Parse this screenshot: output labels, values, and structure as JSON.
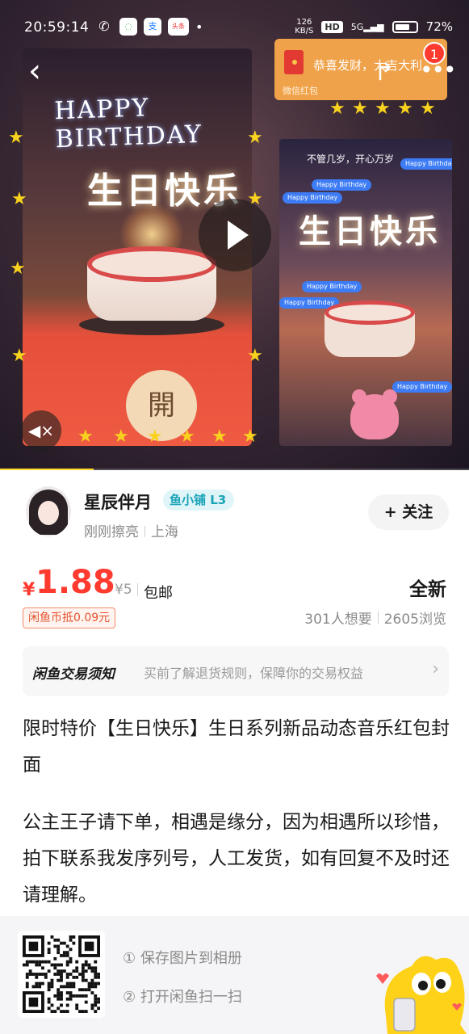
{
  "status_bar": {
    "time": "20:59:14",
    "app_icons": [
      {
        "name": "wechat-icon",
        "glyph": "✆",
        "color": "#ffffff"
      },
      {
        "name": "refresh-app-icon",
        "glyph": "◌",
        "color": "#4cc45a"
      },
      {
        "name": "alipay-icon",
        "glyph": "支",
        "color": "#1677ff"
      },
      {
        "name": "toutiao-icon",
        "glyph": "头条",
        "color": "#e83a35"
      }
    ],
    "net_speed_value": "126",
    "net_speed_unit": "KB/S",
    "hd_label": "HD",
    "signal_label": "5G",
    "battery": "72%"
  },
  "hero": {
    "banner_text": "HAPPY BIRTHDAY",
    "left_title": "生日快乐",
    "open_seal": "開",
    "right_title": "生日快乐",
    "right_caption": "不管几岁，开心万岁",
    "chat_bubble_text": "Happy Birthday",
    "notice_text": "恭喜发财，大吉大利",
    "notice_sub": "微信红包",
    "notification_count": "1",
    "video_progress": 0.2,
    "icons": {
      "back": "back-arrow-icon",
      "share": "share-icon",
      "more": "more-icon",
      "play": "play-icon",
      "mute": "mute-icon"
    },
    "accent": "#f8d21e"
  },
  "seller": {
    "name": "星辰伴月",
    "level": "鱼小铺 L3",
    "status": "刚刚擦亮",
    "location": "上海",
    "follow_plus": "+",
    "follow_label": "关注"
  },
  "price": {
    "currency": "¥",
    "value": "1.88",
    "original": "¥5",
    "shipping": "包邮",
    "coin_deduct": "闲鱼币抵0.09元",
    "condition": "全新",
    "wants": "301人想要",
    "views": "2605浏览",
    "color": "#ff3b30"
  },
  "trade_notice": {
    "title": "闲鱼交易须知",
    "description": "买前了解退货规则，保障你的交易权益",
    "chevron": "›"
  },
  "description": {
    "title": "限时特价【生日快乐】生日系列新品动态音乐红包封面",
    "body": "公主王子请下单，相遇是缘分，因为相遇所以珍惜，拍下联系我发序列号，人工发货，如有回复不及时还请理解。"
  },
  "save_panel": {
    "step1": "① 保存图片到相册",
    "step2": "② 打开闲鱼扫一扫"
  }
}
